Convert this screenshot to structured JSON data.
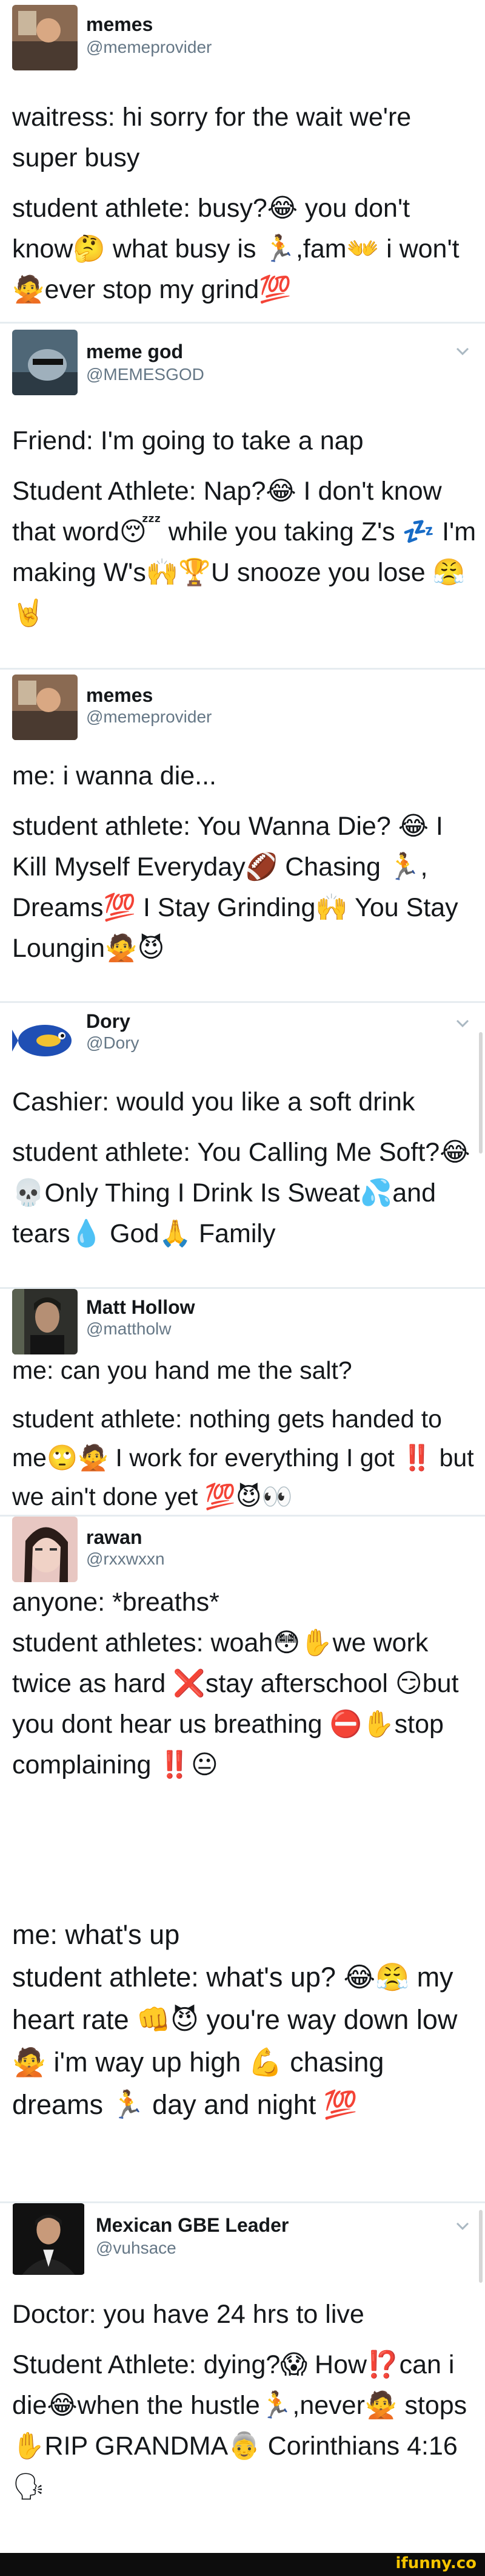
{
  "tweets": [
    {
      "name": "memes",
      "handle": "@memeprovider",
      "lines": [
        "waitress: hi sorry for the wait we're super busy",
        "student athlete: busy?😂 you don't know🤔 what busy is 🏃,fam👐 i won't🙅ever stop my grind💯"
      ]
    },
    {
      "name": "meme god",
      "handle": "@MEMESGOD",
      "lines": [
        "Friend: I'm going to take a nap",
        "Student Athlete: Nap?😂 I don't know that word😴 while you taking Z's 💤 I'm making W's🙌🏆U snooze you lose 😤🤘"
      ]
    },
    {
      "name": "memes",
      "handle": "@memeprovider",
      "lines": [
        "me: i wanna die...",
        "student athlete: You Wanna Die? 😂 I Kill Myself Everyday🏈 Chasing 🏃, Dreams💯 I Stay Grinding🙌 You Stay Loungin🙅😈"
      ]
    },
    {
      "name": "Dory",
      "handle": "@Dory",
      "lines": [
        "Cashier: would you like a soft drink",
        "student athlete: You Calling Me Soft?😂💀Only Thing I Drink Is Sweat💦and tears💧 God🙏 Family"
      ]
    },
    {
      "name": "Matt Hollow",
      "handle": "@mattholw",
      "lines": [
        "me: can you hand me the salt?",
        "student athlete: nothing gets handed to me🙄🙅 I work for everything I got ‼️ but we ain't done yet 💯😈👀"
      ]
    },
    {
      "name": "rawan",
      "handle": "@rxxwxxn",
      "lines": [
        "anyone: *breaths*",
        "student athletes: woah😳✋we work twice as hard ❌stay afterschool 😏but you dont hear us breathing ⛔✋stop complaining ‼️😐"
      ]
    },
    {
      "name": "",
      "handle": "",
      "lines": [
        "me: what's up",
        "student athlete: what's up? 😂😤 my heart rate 👊😈 you're way down low 🙅 i'm way up high 💪 chasing dreams 🏃 day and night 💯"
      ]
    },
    {
      "name": "Mexican GBE Leader",
      "handle": "@vuhsace",
      "lines": [
        "Doctor: you have 24 hrs to live",
        "Student Athlete: dying?😱 How⁉️can i die😂when the hustle🏃,never🙅 stops✋RIP GRANDMA👵 Corinthians 4:16 🗣"
      ]
    }
  ],
  "watermark": "ifunny.co",
  "colors": {
    "handle": "#657786",
    "text": "#14171a",
    "divider": "#e6ecf0",
    "watermark": "#f5c400"
  }
}
